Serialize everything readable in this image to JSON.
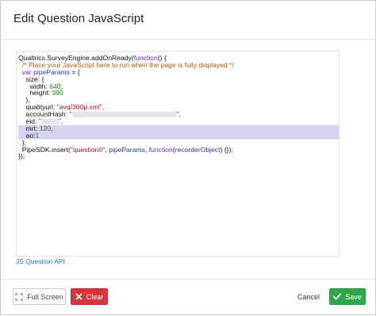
{
  "dialog": {
    "title": "Edit Question JavaScript"
  },
  "editor": {
    "lines": [
      {
        "segments": [
          {
            "t": "Qualtrics.SurveyEngine.addOnReady(",
            "c": "plain"
          },
          {
            "t": "function",
            "c": "kw"
          },
          {
            "t": "() {",
            "c": "plain"
          }
        ]
      },
      {
        "segments": [
          {
            "t": "  /* Place your JavaScript here to run when the page is fully displayed */",
            "c": "cmt"
          }
        ]
      },
      {
        "segments": [
          {
            "t": "  ",
            "c": "plain"
          },
          {
            "t": "var",
            "c": "kw"
          },
          {
            "t": " ",
            "c": "plain"
          },
          {
            "t": "pipeParams",
            "c": "var"
          },
          {
            "t": " = {",
            "c": "plain"
          }
        ]
      },
      {
        "segments": [
          {
            "t": "    size: {",
            "c": "plain"
          }
        ]
      },
      {
        "segments": [
          {
            "t": "      width: ",
            "c": "plain"
          },
          {
            "t": "640",
            "c": "num"
          },
          {
            "t": ",",
            "c": "plain"
          }
        ]
      },
      {
        "segments": [
          {
            "t": "      height: ",
            "c": "plain"
          },
          {
            "t": "390",
            "c": "num"
          }
        ]
      },
      {
        "segments": [
          {
            "t": "    },",
            "c": "plain"
          }
        ]
      },
      {
        "segments": [
          {
            "t": "    qualityurl: ",
            "c": "plain"
          },
          {
            "t": "\"avq/360p.xml\"",
            "c": "str"
          },
          {
            "t": ",",
            "c": "plain"
          }
        ]
      },
      {
        "segments": [
          {
            "t": "    accountHash: ",
            "c": "plain"
          },
          {
            "t": "\"",
            "c": "str"
          },
          {
            "t": "",
            "c": "redact",
            "w": 132
          },
          {
            "t": "\"",
            "c": "str"
          },
          {
            "t": ",",
            "c": "plain"
          }
        ]
      },
      {
        "segments": [
          {
            "t": "    eid: ",
            "c": "plain"
          },
          {
            "t": "\"",
            "c": "str"
          },
          {
            "t": "",
            "c": "redact",
            "w": 22
          },
          {
            "t": "\"",
            "c": "str"
          },
          {
            "t": ",",
            "c": "plain"
          }
        ]
      },
      {
        "segments": [
          {
            "t": "    mrt: ",
            "c": "plain"
          },
          {
            "t": "120",
            "c": "num"
          },
          {
            "t": ",",
            "c": "plain"
          }
        ],
        "hl": true
      },
      {
        "segments": [
          {
            "t": "    ao:",
            "c": "plain"
          },
          {
            "t": "1",
            "c": "num"
          }
        ],
        "hl": true
      },
      {
        "segments": [
          {
            "t": "  };",
            "c": "plain"
          }
        ]
      },
      {
        "segments": [
          {
            "t": "  PipeSDK.insert(",
            "c": "plain"
          },
          {
            "t": "\"question0\"",
            "c": "str"
          },
          {
            "t": ", ",
            "c": "plain"
          },
          {
            "t": "pipeParams",
            "c": "var"
          },
          {
            "t": ", ",
            "c": "plain"
          },
          {
            "t": "function",
            "c": "kw"
          },
          {
            "t": "(",
            "c": "plain"
          },
          {
            "t": "recorderObject",
            "c": "var"
          },
          {
            "t": ") {});",
            "c": "plain"
          }
        ]
      },
      {
        "segments": [
          {
            "t": "});",
            "c": "plain"
          }
        ]
      }
    ]
  },
  "links": {
    "api": "JS Question API"
  },
  "footer": {
    "full_screen": "Full Screen",
    "clear": "Clear",
    "cancel": "Cancel",
    "save": "Save"
  },
  "colors": {
    "clear_bg": "#d6363a",
    "save_bg": "#2ea84a",
    "link": "#1a73c9",
    "highlight": "#d9d3f1"
  },
  "icons": {
    "full_screen": "expand-icon",
    "clear": "x-icon",
    "save": "check-icon"
  }
}
